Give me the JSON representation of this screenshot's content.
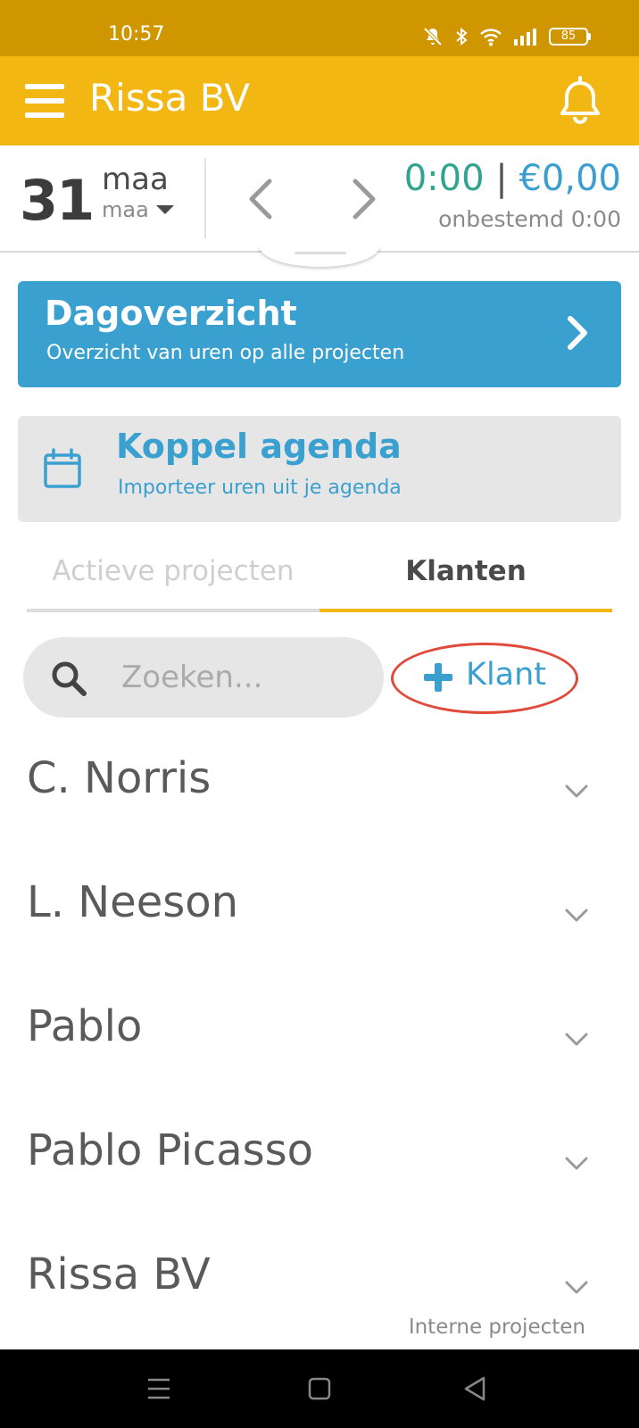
{
  "status_bar": {
    "time": "10:57",
    "battery": "85",
    "icons": [
      "mute-icon",
      "bluetooth-icon",
      "wifi-icon",
      "signal-icon",
      "battery-icon"
    ]
  },
  "app_bar": {
    "title": "Rissa BV",
    "menu_icon": "hamburger-menu-icon",
    "notification_icon": "bell-icon"
  },
  "date_bar": {
    "day": "31",
    "month": "maa",
    "month_select": "maa",
    "hours": "0:00",
    "separator": "|",
    "amount": "€0,00",
    "undetermined": "onbestemd 0:00"
  },
  "day_overview": {
    "title": "Dagoverzicht",
    "subtitle": "Overzicht van uren op alle projecten"
  },
  "agenda": {
    "title": "Koppel agenda",
    "subtitle": "Importeer uren uit je agenda"
  },
  "tabs": [
    {
      "label": "Actieve projecten",
      "active": false
    },
    {
      "label": "Klanten",
      "active": true
    }
  ],
  "search": {
    "placeholder": "Zoeken..."
  },
  "add_client": {
    "label": "Klant"
  },
  "clients": [
    {
      "name": "C. Norris",
      "note": ""
    },
    {
      "name": "L. Neeson",
      "note": ""
    },
    {
      "name": "Pablo",
      "note": ""
    },
    {
      "name": "Pablo Picasso",
      "note": ""
    },
    {
      "name": "Rissa BV",
      "note": "Interne projecten"
    }
  ],
  "colors": {
    "status_bar": "#cf9600",
    "app_bar": "#f2b712",
    "accent_blue": "#3aa0d0",
    "accent_green": "#2fa48e",
    "highlight_ring": "#e04a3a"
  }
}
